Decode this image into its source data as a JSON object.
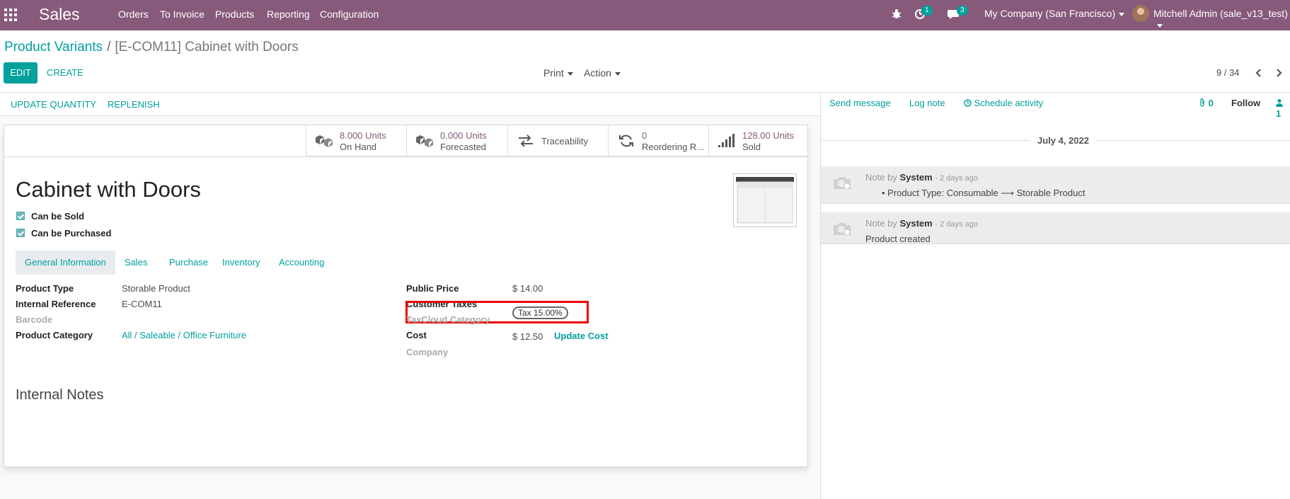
{
  "navbar": {
    "app_name": "Sales",
    "menu": [
      "Orders",
      "To Invoice",
      "Products",
      "Reporting",
      "Configuration"
    ],
    "activity_count": "1",
    "message_count": "3",
    "company": "My Company (San Francisco)",
    "user": "Mitchell Admin (sale_v13_test)"
  },
  "control_panel": {
    "breadcrumb_parent": "Product Variants",
    "breadcrumb_sep": "/",
    "breadcrumb_current": "[E-COM11] Cabinet with Doors",
    "edit_label": "EDIT",
    "create_label": "CREATE",
    "print_label": "Print",
    "action_label": "Action",
    "pager": "9 / 34"
  },
  "statusbar": {
    "update_quantity": "UPDATE QUANTITY",
    "replenish": "REPLENISH"
  },
  "smart_buttons": {
    "on_hand_value": "8.000 Units",
    "on_hand_label": "On Hand",
    "forecasted_value": "0.000 Units",
    "forecasted_label": "Forecasted",
    "traceability_label": "Traceability",
    "reordering_value": "0",
    "reordering_label": "Reordering R...",
    "sold_value": "128.00 Units",
    "sold_label": "Sold"
  },
  "product": {
    "name": "Cabinet with Doors",
    "can_be_sold": "Can be Sold",
    "can_be_purchased": "Can be Purchased"
  },
  "tabs": [
    "General Information",
    "Sales",
    "Purchase",
    "Inventory",
    "Accounting"
  ],
  "fields": {
    "product_type_label": "Product Type",
    "product_type_value": "Storable Product",
    "internal_ref_label": "Internal Reference",
    "internal_ref_value": "E-COM11",
    "barcode_label": "Barcode",
    "category_label": "Product Category",
    "category_value": "All / Saleable / Office Furniture",
    "public_price_label": "Public Price",
    "public_price_value": "$ 14.00",
    "customer_taxes_label": "Customer Taxes",
    "customer_taxes_value": "Tax 15.00%",
    "taxcloud_label": "TaxCloud Category",
    "cost_label": "Cost",
    "cost_value": "$ 12.50",
    "update_cost": "Update Cost",
    "company_label": "Company"
  },
  "internal_notes": "Internal Notes",
  "chatter": {
    "send_message": "Send message",
    "log_note": "Log note",
    "schedule_activity": "Schedule activity",
    "attachments": "0",
    "follow": "Follow",
    "followers": "1",
    "date": "July 4, 2022",
    "messages": [
      {
        "prefix": "Note by",
        "author": "System",
        "time": "- 2 days ago",
        "body": "Product Type: Consumable ⟶ Storable Product"
      },
      {
        "prefix": "Note by",
        "author": "System",
        "time": "- 2 days ago",
        "body": "Product created"
      }
    ]
  }
}
